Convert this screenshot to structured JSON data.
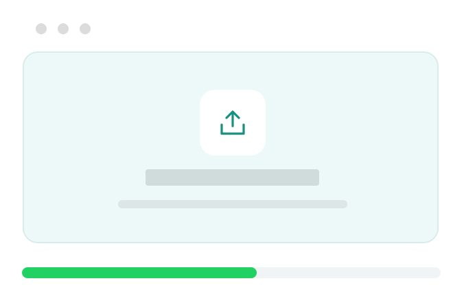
{
  "window": {
    "controls": [
      "close",
      "minimize",
      "maximize"
    ]
  },
  "dropzone": {
    "icon": "upload-icon",
    "icon_color": "#16907f",
    "background_color": "#edf8f8"
  },
  "progress": {
    "percent": 56,
    "fill_color": "#22d163"
  }
}
